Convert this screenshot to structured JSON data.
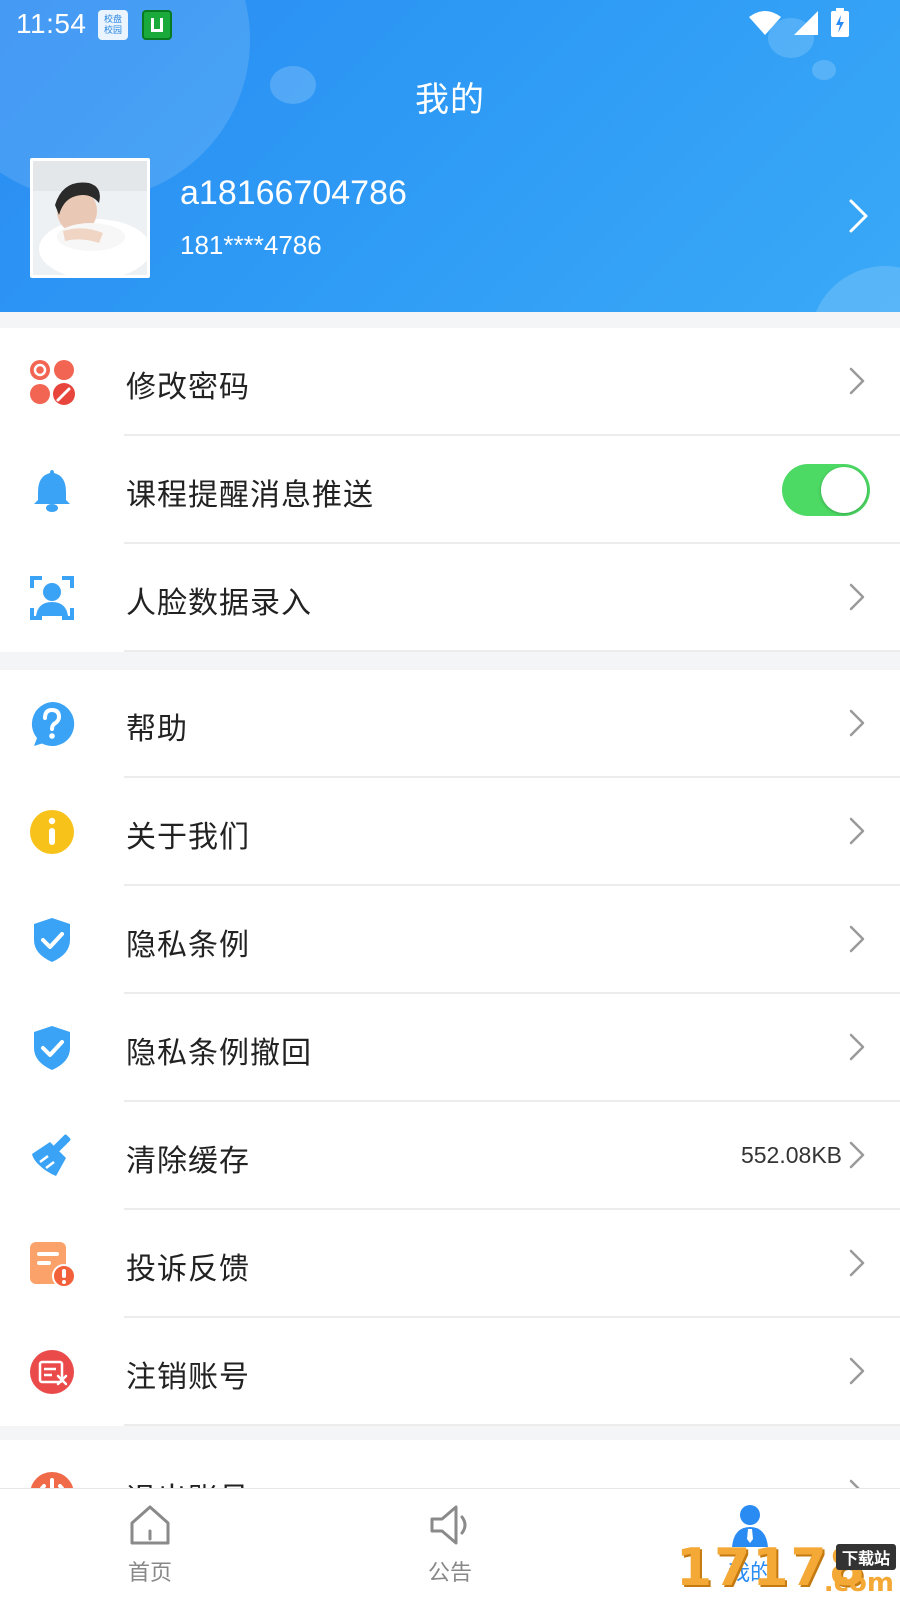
{
  "status_bar": {
    "time": "11:54",
    "app_badge_1": "校盘\n校园",
    "icons": [
      "wifi-icon",
      "signal-icon",
      "battery-charging-icon"
    ]
  },
  "header": {
    "title": "我的",
    "username": "a18166704786",
    "phone": "181****4786"
  },
  "menu_group_1": [
    {
      "label": "修改密码",
      "icon": "change-password-icon"
    },
    {
      "label": "课程提醒消息推送",
      "icon": "bell-icon",
      "toggle_on": true
    },
    {
      "label": "人脸数据录入",
      "icon": "face-scan-icon"
    }
  ],
  "menu_group_2": [
    {
      "label": "帮助",
      "icon": "help-icon"
    },
    {
      "label": "关于我们",
      "icon": "info-icon"
    },
    {
      "label": "隐私条例",
      "icon": "shield-check-icon"
    },
    {
      "label": "隐私条例撤回",
      "icon": "shield-check-icon"
    },
    {
      "label": "清除缓存",
      "icon": "broom-icon",
      "value": "552.08KB"
    },
    {
      "label": "投诉反馈",
      "icon": "feedback-icon"
    },
    {
      "label": "注销账号",
      "icon": "deactivate-account-icon"
    }
  ],
  "menu_group_3": [
    {
      "label": "退出账号",
      "icon": "logout-icon"
    }
  ],
  "tabbar": {
    "home": "首页",
    "notice": "公告",
    "mine": "我的",
    "active": "mine"
  },
  "watermark": {
    "number": "17178",
    "tag": "下载站",
    "domain": ".com"
  },
  "colors": {
    "header_gradient_start": "#2a8bf2",
    "header_gradient_end": "#3aa9f7",
    "toggle_on": "#4cd964",
    "tab_active": "#2a8bf2",
    "tab_inactive": "#888888"
  }
}
